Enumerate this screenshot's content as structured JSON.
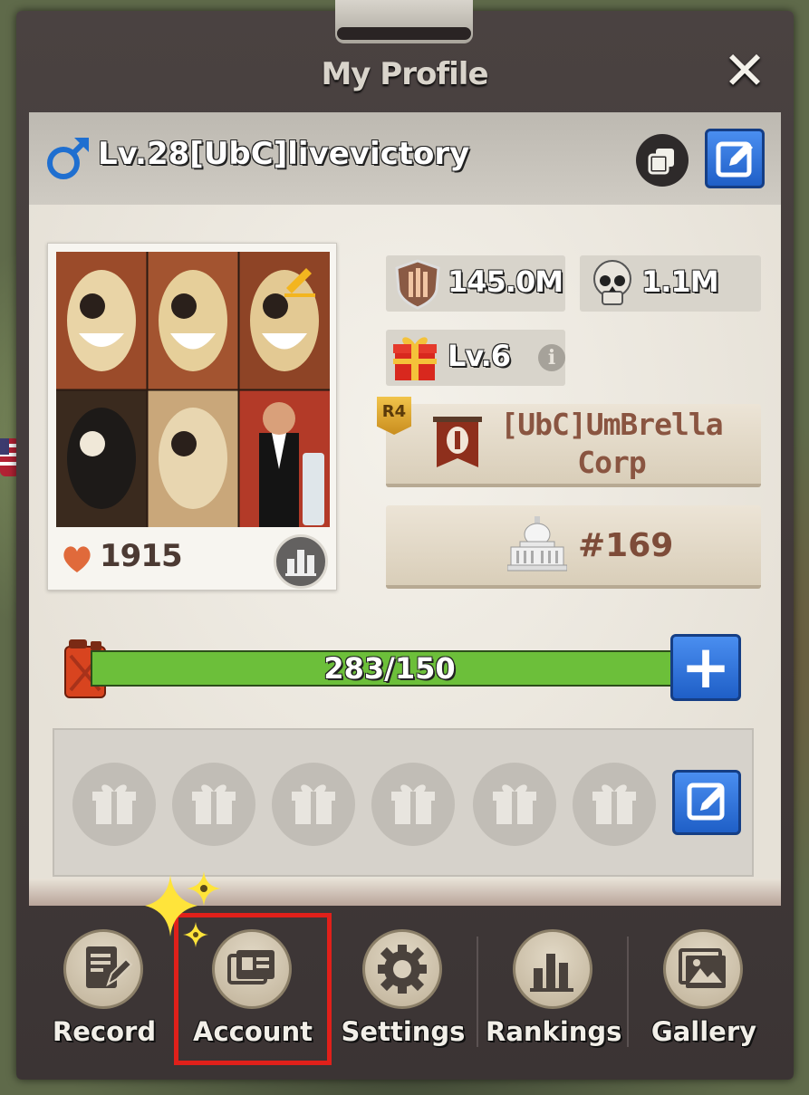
{
  "window": {
    "title": "My Profile",
    "close_symbol": "✕"
  },
  "player": {
    "gender_icon": "male-icon",
    "name": "Lv.28[UbC]livevictory",
    "likes": "1915"
  },
  "stats": {
    "power": "145.0M",
    "kills": "1.1M",
    "gift_level": "Lv.6"
  },
  "alliance": {
    "rank_badge": "R4",
    "name_line1": "[UbC]UmBrella",
    "name_line2": "Corp"
  },
  "ranking": {
    "value": "#169"
  },
  "fuel": {
    "text": "283/150",
    "fill_fraction": 1.0,
    "plus_symbol": "+"
  },
  "gift_slots_count": 6,
  "nav": {
    "items": [
      {
        "label": "Record",
        "icon": "document-pen-icon"
      },
      {
        "label": "Account",
        "icon": "id-card-icon"
      },
      {
        "label": "Settings",
        "icon": "gear-icon"
      },
      {
        "label": "Rankings",
        "icon": "bar-chart-icon"
      },
      {
        "label": "Gallery",
        "icon": "picture-icon"
      }
    ],
    "highlighted": "Account"
  },
  "colors": {
    "edit_blue": "#2e73db",
    "fuel_green": "#6cbf3a",
    "alliance_text": "#8a5541",
    "highlight_red": "#e0201a"
  }
}
